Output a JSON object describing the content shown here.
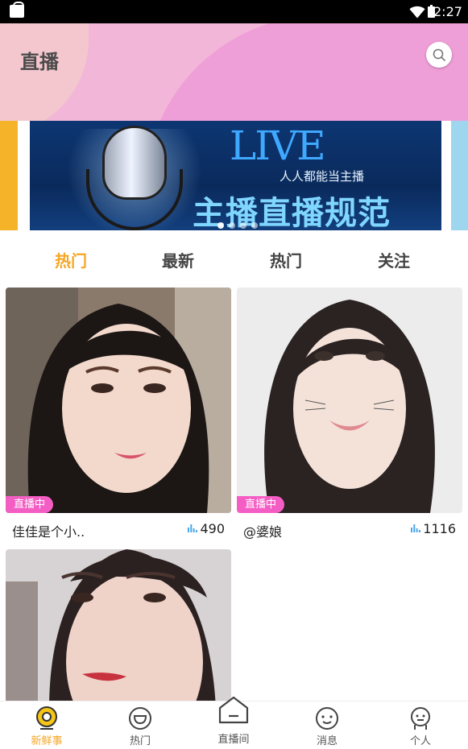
{
  "status_bar": {
    "time": "2:27"
  },
  "header": {
    "title": "直播"
  },
  "banner": {
    "headline": "LIVE",
    "subline": "人人都能当主播",
    "main_text": "主播直播规范",
    "page_count": 4,
    "active_index": 0
  },
  "tabs": [
    {
      "label": "热门",
      "active": true
    },
    {
      "label": "最新",
      "active": false
    },
    {
      "label": "热门",
      "active": false
    },
    {
      "label": "关注",
      "active": false
    }
  ],
  "cards": [
    {
      "badge": "直播中",
      "name": "佳佳是个小..",
      "viewers": "490"
    },
    {
      "badge": "直播中",
      "name": "@婆娘",
      "viewers": "1116"
    },
    {
      "badge": "",
      "name": "",
      "viewers": ""
    }
  ],
  "bottom_nav": [
    {
      "label": "新鲜事",
      "icon": "camera-icon",
      "active": true
    },
    {
      "label": "热门",
      "icon": "smile-face-icon",
      "active": false
    },
    {
      "label": "直播间",
      "icon": "house-icon",
      "active": false
    },
    {
      "label": "消息",
      "icon": "chat-face-icon",
      "active": false
    },
    {
      "label": "个人",
      "icon": "person-face-icon",
      "active": false
    }
  ],
  "colors": {
    "accent": "#f5a623",
    "badge": "#f45ec4",
    "header_pink": "#ef9fd7"
  }
}
